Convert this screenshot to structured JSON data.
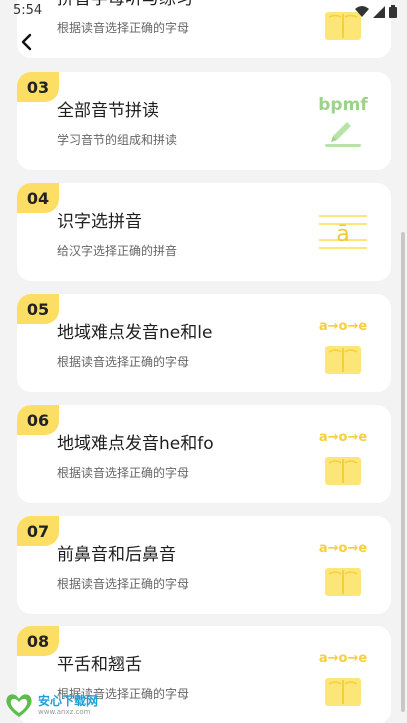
{
  "status": {
    "time": "5:54"
  },
  "colors": {
    "accent": "#fdde64",
    "icon_green": "#9bd38a",
    "icon_yellow": "#fde678"
  },
  "cards": [
    {
      "number": "",
      "title": "拼音字母听与练习",
      "subtitle": "根据读音选择正确的字母",
      "icon": "book-icon"
    },
    {
      "number": "03",
      "title": "全部音节拼读",
      "subtitle": "学习音节的组成和拼读",
      "icon": "bpmf-icon",
      "icon_text": "bpmf"
    },
    {
      "number": "04",
      "title": "识字选拼音",
      "subtitle": "给汉字选择正确的拼音",
      "icon": "pinyin-a-icon",
      "icon_text": "ā"
    },
    {
      "number": "05",
      "title": "地域难点发音ne和le",
      "subtitle": "根据读音选择正确的字母",
      "icon": "aoe-book-icon",
      "icon_text": "a→o→e"
    },
    {
      "number": "06",
      "title": "地域难点发音he和fo",
      "subtitle": "根据读音选择正确的字母",
      "icon": "aoe-book-icon",
      "icon_text": "a→o→e"
    },
    {
      "number": "07",
      "title": "前鼻音和后鼻音",
      "subtitle": "根据读音选择正确的字母",
      "icon": "aoe-book-icon",
      "icon_text": "a→o→e"
    },
    {
      "number": "08",
      "title": "平舌和翘舌",
      "subtitle": "根据读音选择正确的字母",
      "icon": "aoe-book-icon",
      "icon_text": "a→o→e"
    }
  ],
  "watermark": {
    "name": "安心下载网",
    "url": "www.anxz.com"
  }
}
